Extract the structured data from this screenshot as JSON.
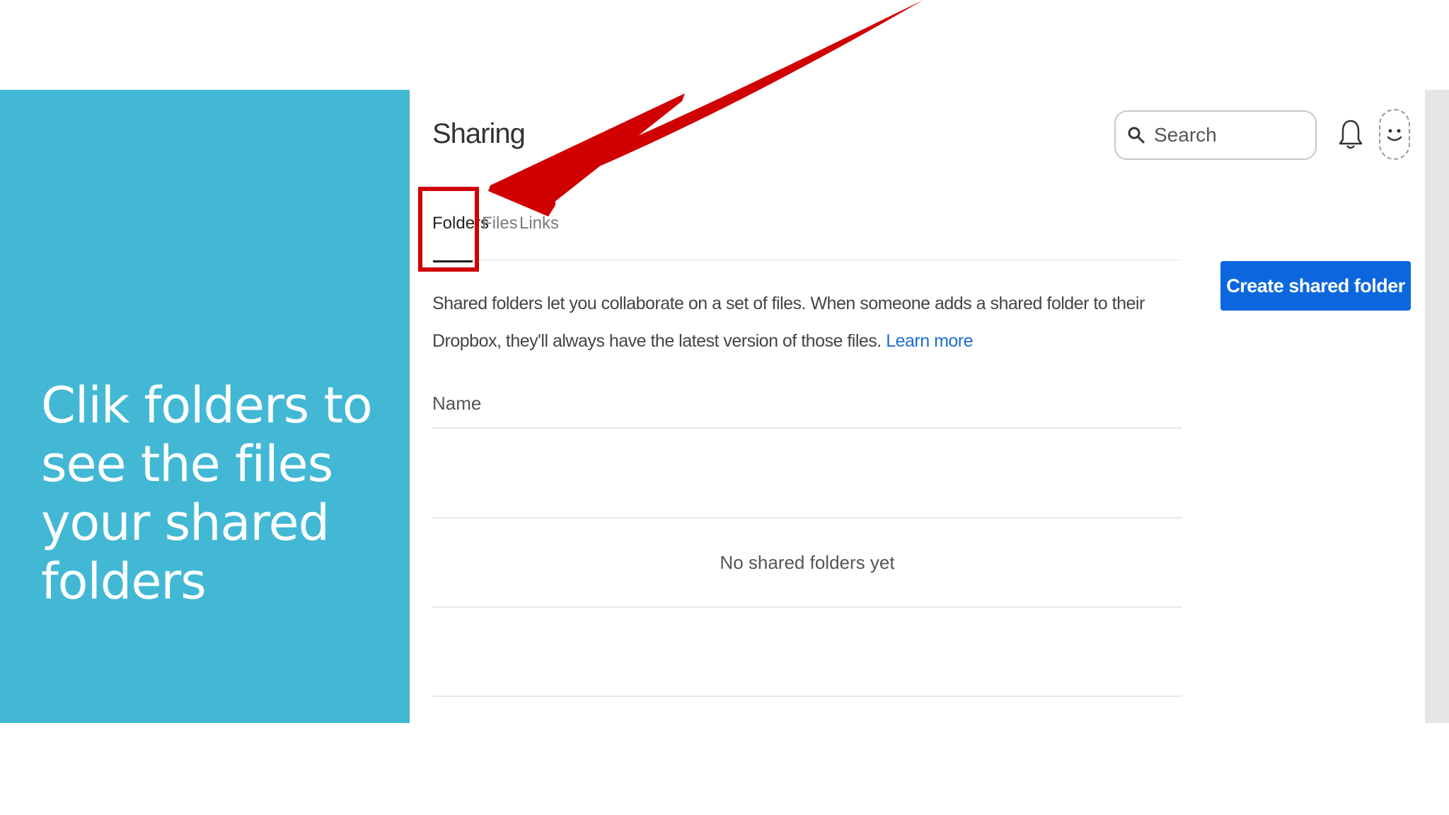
{
  "slide": {
    "heading": "Clik folders to see the files your shared folders"
  },
  "header": {
    "title": "Sharing",
    "search_placeholder": "Search"
  },
  "tabs": [
    {
      "label": "Folders",
      "active": true
    },
    {
      "label": "Files",
      "active": false
    },
    {
      "label": "Links",
      "active": false
    }
  ],
  "content": {
    "description": "Shared folders let you collaborate on a set of files. When someone adds a shared folder to their Dropbox, they'll always have the latest version of those files.",
    "learn_more": "Learn more",
    "create_button": "Create shared folder",
    "table_header": "Name",
    "empty_message": "No shared folders yet"
  },
  "colors": {
    "slide_panel": "#42b8d5",
    "primary_button": "#0c67de",
    "link": "#1e6cd2",
    "annotation": "#d00000"
  },
  "icons": {
    "search": "search-icon",
    "notifications": "bell-icon",
    "avatar": "smiley-face-icon"
  }
}
